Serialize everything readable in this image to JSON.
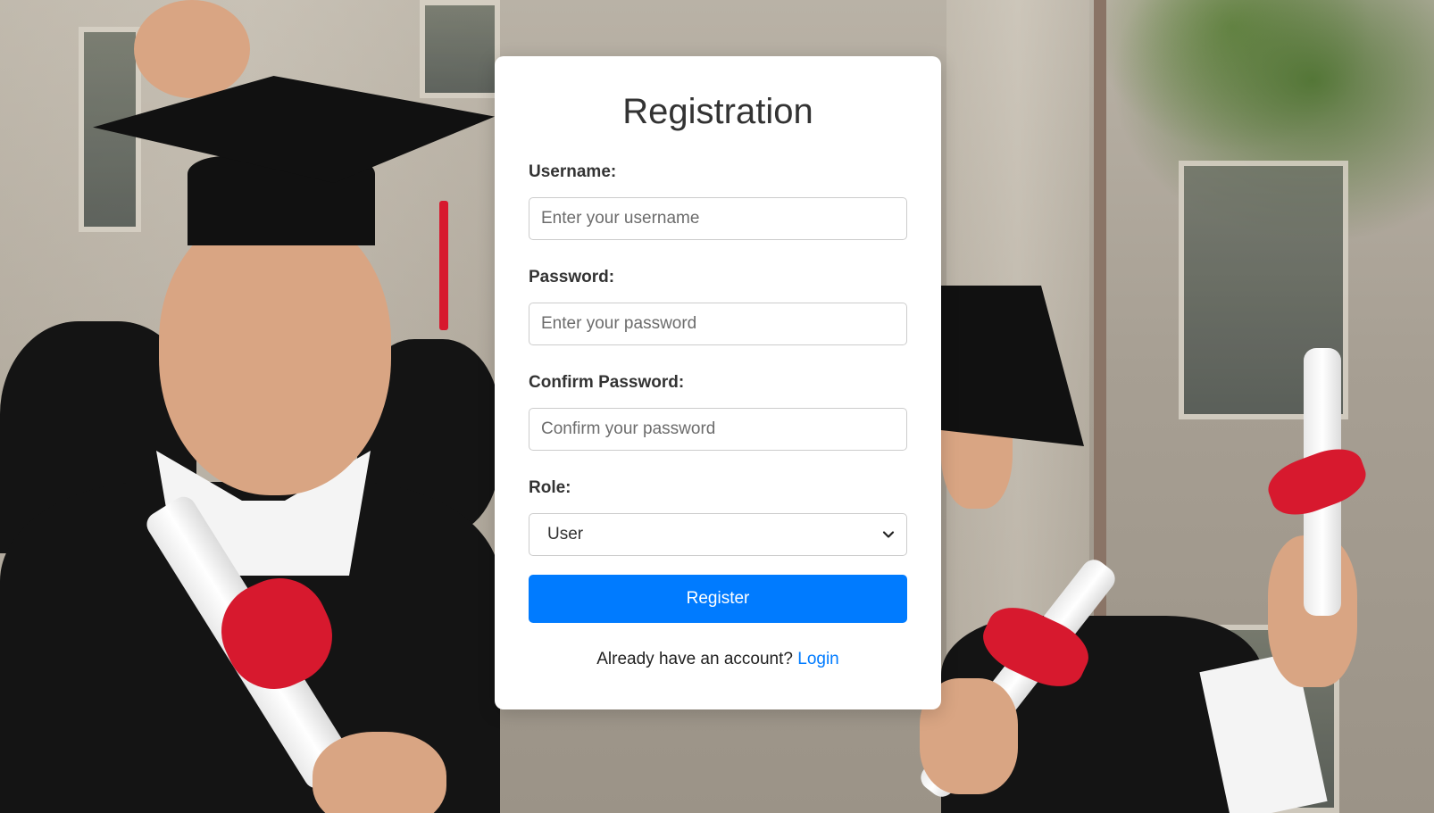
{
  "form": {
    "title": "Registration",
    "username": {
      "label": "Username:",
      "placeholder": "Enter your username",
      "value": ""
    },
    "password": {
      "label": "Password:",
      "placeholder": "Enter your password",
      "value": ""
    },
    "confirm_password": {
      "label": "Confirm Password:",
      "placeholder": "Confirm your password",
      "value": ""
    },
    "role": {
      "label": "Role:",
      "selected": "User"
    },
    "submit_label": "Register",
    "login_prompt": "Already have an account?",
    "login_link": "Login"
  },
  "colors": {
    "primary": "#007bff",
    "card_background": "#ffffff",
    "text": "#333333"
  },
  "icons": {
    "role_select": "chevron-down-icon"
  }
}
